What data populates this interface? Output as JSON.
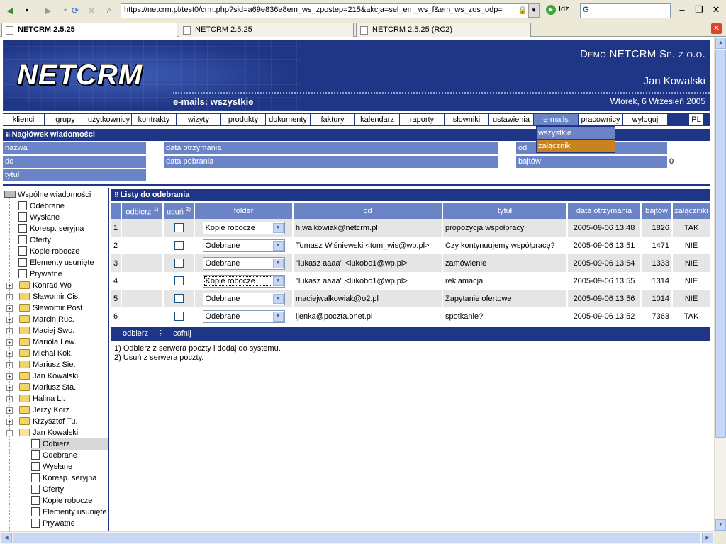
{
  "browser": {
    "url": "https://netcrm.pl/test0/crm.php?sid=a69e836e8em_ws_zpostep=215&akcja=sel_em_ws_f&em_ws_zos_odp=",
    "go_label": "Idź",
    "search_logo": "G",
    "tabs": [
      {
        "title": "NETCRM 2.5.25",
        "active": true
      },
      {
        "title": "NETCRM 2.5.25",
        "active": false
      },
      {
        "title": "NETCRM 2.5.25 (RC2)",
        "active": false
      }
    ]
  },
  "header": {
    "logo": "NETCRM",
    "company": "Demo NETCRM Sp. z o.o.",
    "user": "Jan Kowalski",
    "page_title": "e-mails: wszystkie",
    "date": "Wtorek, 6 Wrzesień 2005"
  },
  "menu": {
    "items": [
      "klienci",
      "grupy",
      "użytkownicy",
      "kontrakty",
      "wizyty",
      "produkty",
      "dokumenty",
      "faktury",
      "kalendarz",
      "raporty",
      "słowniki",
      "ustawienia",
      "e-mails",
      "pracownicy",
      "wyloguj"
    ],
    "lang": "PL",
    "dropdown": [
      "wszystkie",
      "załączniki"
    ]
  },
  "message_header": {
    "title": "Nagłówek wiadomości",
    "fields": {
      "nazwa": "nazwa",
      "do": "do",
      "tytul": "tytuł",
      "data_otrzymania": "data otrzymania",
      "data_pobrania": "data pobrania",
      "od": "od",
      "bajtow": "bajtów",
      "bajtow_value": "0"
    }
  },
  "tree": {
    "root": "Wspólne wiadomości",
    "shared": [
      "Odebrane",
      "Wysłane",
      "Koresp. seryjna",
      "Oferty",
      "Kopie robocze",
      "Elementy usunięte",
      "Prywatne"
    ],
    "users": [
      "Konrad Wo",
      "Sławomir Cis.",
      "Sławomir Post",
      "Marcin Ruc.",
      "Maciej Swo.",
      "Mariola Lew.",
      "Michał Kok.",
      "Mariusz Sie.",
      "Jan Kowalski",
      "Mariusz Sta.",
      "Halina Li.",
      "Jerzy Korz.",
      "Krzysztof Tu.",
      "Jan Kowalski"
    ],
    "expanded_children": [
      "Odbierz",
      "Odebrane",
      "Wysłane",
      "Koresp. seryjna",
      "Oferty",
      "Kopie robocze",
      "Elementy usunięte",
      "Prywatne"
    ]
  },
  "mail_list": {
    "title": "Listy do odebrania",
    "columns": [
      "odbierz",
      "usuń",
      "folder",
      "od",
      "tytuł",
      "data otrzymania",
      "bajtów",
      "załączniki"
    ],
    "col_notes": [
      "1)",
      "2)"
    ],
    "rows": [
      {
        "n": "1",
        "folder": "Kopie robocze",
        "from": "h.walkowiak@netcrm.pl",
        "subject": "propozycja współpracy",
        "date": "2005-09-06 13:48",
        "bytes": "1826",
        "att": "TAK"
      },
      {
        "n": "2",
        "folder": "Odebrane",
        "from": "Tomasz Wiśniewski <tom_wis@wp.pl>",
        "subject": "Czy kontynuujemy współpracę?",
        "date": "2005-09-06 13:51",
        "bytes": "1471",
        "att": "NIE"
      },
      {
        "n": "3",
        "folder": "Odebrane",
        "from": "\"lukasz aaaa\" <lukobo1@wp.pl>",
        "subject": "zamówienie",
        "date": "2005-09-06 13:54",
        "bytes": "1333",
        "att": "NIE"
      },
      {
        "n": "4",
        "folder": "Kopie robocze",
        "from": "\"lukasz aaaa\" <lukobo1@wp.pl>",
        "subject": "reklamacja",
        "date": "2005-09-06 13:55",
        "bytes": "1314",
        "att": "NIE"
      },
      {
        "n": "5",
        "folder": "Odebrane",
        "from": "maciejwalkowiak@o2.pl",
        "subject": "Zapytanie ofertowe",
        "date": "2005-09-06 13:56",
        "bytes": "1014",
        "att": "NIE"
      },
      {
        "n": "6",
        "folder": "Odebrane",
        "from": "ljenka@poczta.onet.pl",
        "subject": "spotkanie?",
        "date": "2005-09-06 13:52",
        "bytes": "7363",
        "att": "TAK"
      }
    ],
    "actions": {
      "receive": "odbierz",
      "back": "cofnij"
    },
    "notes": [
      "1) Odbierz z serwera poczty i dodaj do systemu.",
      "2) Usuń z serwera poczty."
    ]
  },
  "colors": {
    "dark_blue": "#1f3585",
    "mid_blue": "#6b84c7",
    "highlight": "#c8821e"
  }
}
